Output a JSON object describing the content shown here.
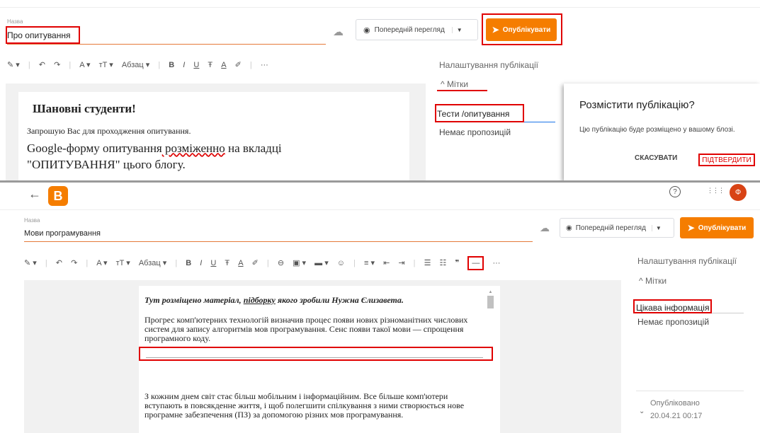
{
  "top": {
    "title_label": "Назва",
    "title_value": "Про опитування",
    "preview_label": "Попередній перегляд",
    "publish_label": "Опублікувати",
    "toolbar": {
      "pen": "✎ ▾",
      "undo": "↶",
      "redo": "↷",
      "text_color": "A ▾",
      "font_size": "ᴛT ▾",
      "paragraph": "Абзац ▾",
      "bold": "B",
      "italic": "I",
      "underline": "U",
      "strike": "Ŧ",
      "color_a": "A",
      "marker": "✐",
      "more": "···"
    },
    "doc": {
      "heading": "Шановні студенти!",
      "line1": "Запрошую Вас для проходження опитування.",
      "line2a": "Google-форму опитування",
      "line2b": " розміженно",
      "line2c": " на вкладці",
      "line3": "\"ОПИТУВАННЯ\" цього блогу."
    },
    "sidebar": {
      "settings": "Налаштування публікації",
      "labels_head": "^ Мітки",
      "labels_value": "Тести /опитування",
      "no_suggestions": "Немає пропозицій"
    },
    "dialog": {
      "title": "Розмістити публікацію?",
      "body": "Цю публікацію буде розміщено у вашому блозі.",
      "cancel": "СКАСУВАТИ",
      "confirm": "ПІДТВЕРДИТИ"
    }
  },
  "bottom": {
    "back": "←",
    "logo": "B",
    "help": "?",
    "apps": "⋮⋮⋮",
    "avatar": "Ф",
    "title_label": "Назва",
    "title_value": "Мови програмування",
    "preview_label": "Попередній перегляд",
    "publish_label": "Опублікувати",
    "toolbar": {
      "pen": "✎ ▾",
      "undo": "↶",
      "redo": "↷",
      "text_color": "A ▾",
      "font_size": "ᴛT ▾",
      "paragraph": "Абзац ▾",
      "bold": "B",
      "italic": "I",
      "underline": "U",
      "strike": "Ŧ",
      "color_a": "A",
      "marker": "✐",
      "link": "⊖",
      "image": "▣ ▾",
      "video": "▬ ▾",
      "emoji": "☺",
      "align": "≡ ▾",
      "indent_less": "⇤",
      "indent_more": "⇥",
      "bullets": "☰",
      "numbers": "☷",
      "quote": "❞",
      "hr": "—",
      "more": "···"
    },
    "doc": {
      "p1a": "Тут розміщено матеріал, ",
      "p1b": "підборку",
      "p1c": " якого зробили Нужна Єлизавета.",
      "p2": "Прогрес комп'ютерних технологій визначив процес появи нових різноманітних числових систем для запису алгоритмів мов програмування. Сенс появи такої мови — спрощення програмного коду.",
      "p3": "З кожним днем світ стає більш мобільним і інформаційним. Все більше комп'ютери вступають в повсякденне життя, і щоб полегшити спілкування з ними створюється нове програмне забезпечення (ПЗ) за допомогою різних мов програмування."
    },
    "sidebar": {
      "settings": "Налаштування публікації",
      "labels_head": "^ Мітки",
      "labels_value": "Цікава інформація",
      "no_suggestions": "Немає пропозицій",
      "published": "Опубліковано",
      "date": "20.04.21 00:17"
    }
  },
  "colors": {
    "accent": "#f57d00",
    "highlight": "#e00000"
  }
}
